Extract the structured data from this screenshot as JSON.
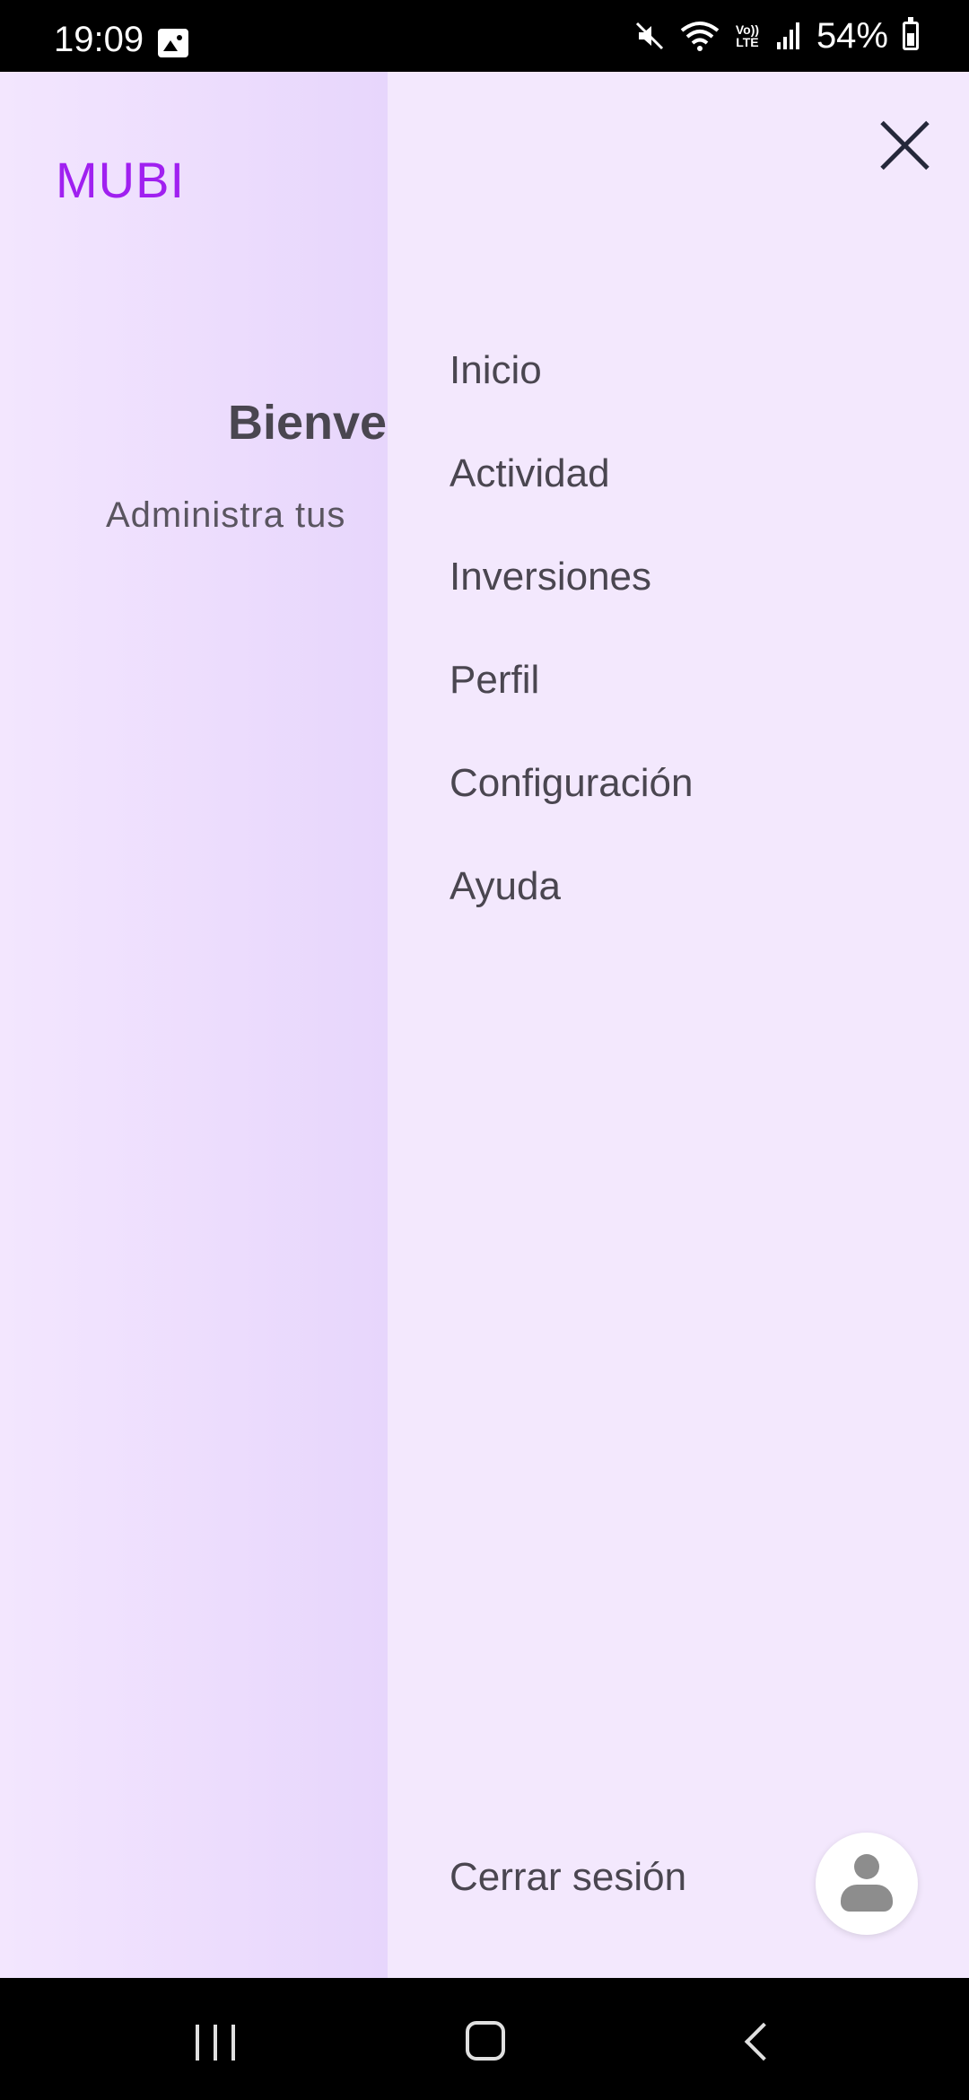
{
  "status_bar": {
    "time": "19:09",
    "battery": "54%",
    "icons": [
      "gallery-icon",
      "mute-icon",
      "wifi-icon",
      "volte-icon",
      "signal-icon",
      "battery-icon"
    ],
    "volte_label": "Vo)) LTE"
  },
  "app": {
    "logo": "MUBI",
    "welcome_title": "Bienver",
    "welcome_subtitle": "Administra tus ",
    "accent_color": "#a020f0",
    "drawer_background": "#f3e8fd"
  },
  "drawer": {
    "menu": [
      {
        "label": "Inicio"
      },
      {
        "label": "Actividad"
      },
      {
        "label": "Inversiones"
      },
      {
        "label": "Perfil"
      },
      {
        "label": "Configuración"
      },
      {
        "label": "Ayuda"
      }
    ],
    "logout": "Cerrar sesión"
  },
  "nav_bar": {
    "buttons": [
      "recents-icon",
      "home-icon",
      "back-icon"
    ]
  }
}
